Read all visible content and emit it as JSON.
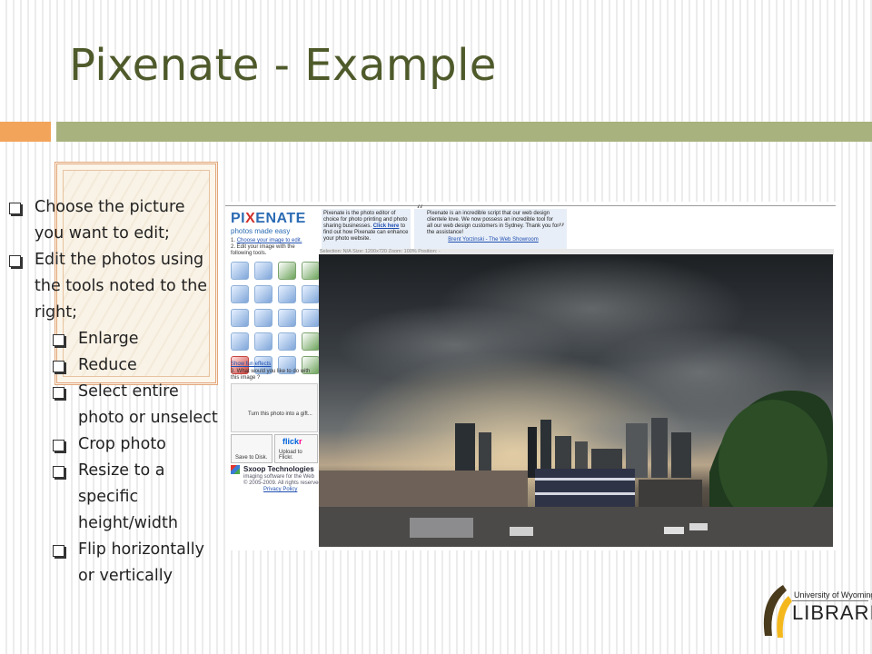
{
  "slide": {
    "title": "Pixenate - Example"
  },
  "bullets": [
    {
      "text": "Choose the picture you want to edit;",
      "level": 1
    },
    {
      "text": "Edit the photos using the tools noted to the right;",
      "level": 1
    },
    {
      "text": "Enlarge",
      "level": 2
    },
    {
      "text": "Reduce",
      "level": 2
    },
    {
      "text": "Select entire photo or unselect",
      "level": 2
    },
    {
      "text": "Crop photo",
      "level": 2
    },
    {
      "text": "Resize to a specific height/width",
      "level": 2
    },
    {
      "text": "Flip horizontally or vertically",
      "level": 2
    }
  ],
  "screenshot": {
    "logo_main": "PI",
    "logo_x": "X",
    "logo_rest": "ENATE",
    "logo_sub": "photos made easy",
    "step1_prefix": "1.",
    "step1_link": "Choose your image to edit.",
    "step2": "2. Edit your image with the following tools.",
    "show_fun_effects": "Show fun effects",
    "step3": "3. What would you like to do with this image ?",
    "gift_caption": "Turn this photo into a gift...",
    "save_to_disk": "Save to Disk.",
    "flickr_prefix": "flick",
    "flickr_r": "r",
    "upload_to_flickr": "Upload to Flickr.",
    "company_name": "Sxoop Technologies",
    "company_tagline": "imaging software for the Web",
    "copyright": "© 2005-2009. All rights reserved.",
    "privacy_policy": "Privacy Policy",
    "info_text_1": "Pixenate is the photo editor of choice for photo printing and photo sharing businesses.",
    "info_link": "Click here",
    "info_text_2": "to find out how Pixenate can enhance your photo website.",
    "testimonial": "Pixenate is an incredible script that our web design clientele love. We now possess an incredible tool for all our web design customers in Sydney. Thank you for the assistance!",
    "testimonial_author": "Brent Yorzinski - The Web Showroom",
    "open_quote": "“",
    "close_quote": "”",
    "status_line": "Selection:  N/A    Size:   1200x720    Zoom:   100%   Position:   -",
    "tool_icons": [
      "rotate-left-icon",
      "rotate-right-icon",
      "flip-vertical-icon",
      "flip-horizontal-icon",
      "zoom-in-icon",
      "zoom-out-icon",
      "select-icon",
      "crop-icon",
      "resize-icon",
      "undo-icon",
      "redo-icon",
      "sharpen-icon",
      "brightness-icon",
      "contrast-icon",
      "whiten-icon",
      "saturation-icon",
      "red-eye-icon",
      "smile-icon",
      "blur-icon",
      "effects-icon"
    ]
  },
  "branding": {
    "university_small": "University of Wyoming",
    "libraries": "LIBRARIES"
  },
  "colors": {
    "title": "#4f5a2b",
    "accent_orange": "#f2a45a",
    "accent_green": "#a7b27e",
    "link_blue": "#1f4fb0",
    "logo_blue": "#2b6bb3",
    "logo_red": "#d0302b",
    "uw_gold": "#f4b81c"
  }
}
